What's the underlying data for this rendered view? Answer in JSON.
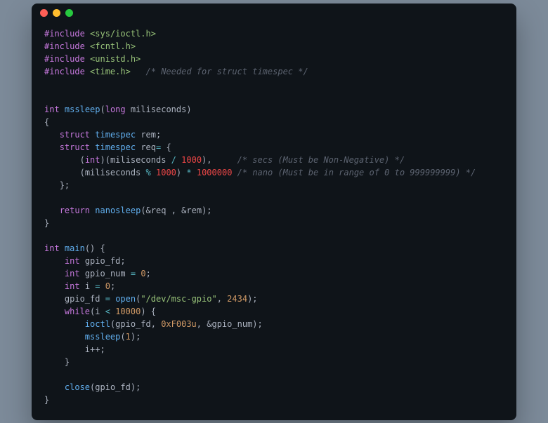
{
  "includes": [
    {
      "header": "<sys/ioctl.h>"
    },
    {
      "header": "<fcntl.h>"
    },
    {
      "header": "<unistd.h>"
    },
    {
      "header": "<time.h>",
      "comment": "/* Needed for struct timespec */"
    }
  ],
  "directive": "#include",
  "func1": {
    "ret": "int",
    "name": "mssleep",
    "param_type": "long",
    "param_name": "miliseconds",
    "struct_kw": "struct",
    "ts_type": "timespec",
    "rem_var": "rem",
    "req_var": "req",
    "cast_int": "int",
    "div_op": "/",
    "mod_op": "%",
    "mul_op": "*",
    "lit1000a": "1000",
    "lit1000b": "1000",
    "lit_million": "1000000",
    "cmt_secs": "/* secs (Must be Non-Negative) */",
    "cmt_nano": "/* nano (Must be in range of 0 to 999999999) */",
    "return_kw": "return",
    "nanosleep": "nanosleep",
    "amp_req": "&req",
    "amp_rem": "&rem"
  },
  "main": {
    "ret": "int",
    "name": "main",
    "int_kw": "int",
    "gpio_fd": "gpio_fd",
    "gpio_num": "gpio_num",
    "eq0": "0",
    "i_var": "i",
    "i_init": "0",
    "open_fn": "open",
    "dev_path": "\"/dev/msc-gpio\"",
    "open_mode": "2434",
    "while_kw": "while",
    "lt_op": "<",
    "limit": "10000",
    "ioctl_fn": "ioctl",
    "ioctl_hex": "0xF003u",
    "amp_gpio_num": "&gpio_num",
    "mssleep_fn": "mssleep",
    "mssleep_arg": "1",
    "ipp": "i++",
    "close_fn": "close"
  }
}
